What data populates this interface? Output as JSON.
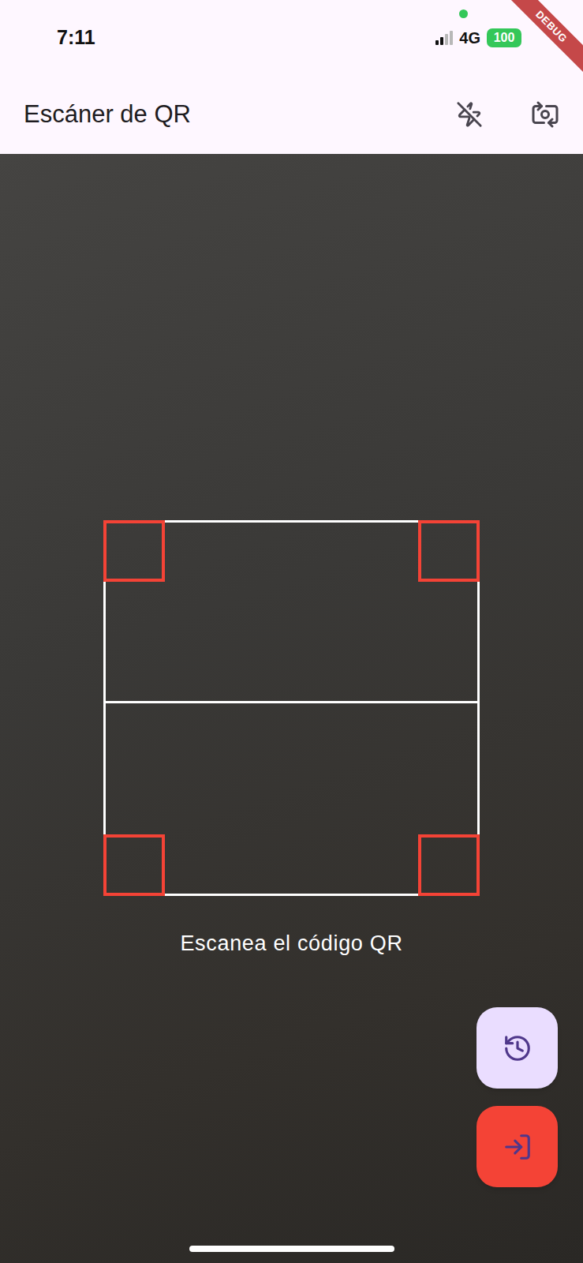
{
  "status_bar": {
    "time": "7:11",
    "network": "4G",
    "battery": "100",
    "signal": {
      "level": 0.5
    },
    "camera_in_use": true
  },
  "debug_banner": "DEBUG",
  "app_bar": {
    "title": "Escáner de QR",
    "flash_on": false
  },
  "scanner": {
    "hint": "Escanea el código QR"
  }
}
